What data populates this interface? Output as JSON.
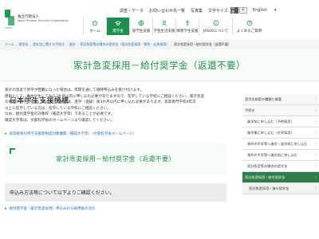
{
  "header": {
    "logo_small": "独立行政法人",
    "logo_main": "日本学生支援機構",
    "logo_en": "Japan Student Services Organization",
    "logo_abbr": "JASSO",
    "utility": [
      "調査・データ",
      "お問い合わせ先一覧",
      "写真集"
    ],
    "font_size_label": "文字サイズ",
    "font_sizes": [
      "標準",
      "大"
    ],
    "language": "English",
    "nav": [
      {
        "label": "ホーム",
        "icon": "home-icon"
      },
      {
        "label": "奨学金",
        "icon": "scholarship-icon"
      },
      {
        "label": "留学生支援",
        "icon": "globe-icon"
      },
      {
        "label": "学生生活支援",
        "icon": "student-icon"
      },
      {
        "label": "障害学生支援",
        "icon": "accessibility-icon"
      },
      {
        "label": "JASSOについて",
        "icon": "info-icon"
      },
      {
        "label": "よくあるご質問",
        "icon": "question-icon"
      }
    ],
    "active_nav_index": 1,
    "accent_color": "#1f8f4e"
  },
  "breadcrumb": [
    "ホーム",
    "奨学金",
    "奨学金に関する手続き",
    "進学",
    "家計急変等の場合の奨学金（家計急変採用・緊急・応急採用）",
    "家計急変採用－給付奨学金（返還不要）"
  ],
  "page_title": "家計急変採用－給付奨学金（返還不要）",
  "intro_lines": [
    "家計の急変で修学が困難になった場合は、年間を通して随時申込みを受け付けます。",
    "原則として、事由が生じてから3か月以内に申し込む必要がありますので、在学している学校にご相談ください。家計急変",
    "の事由が進学（進級）後に生じた場合は、進学（進級）後3か月以内に申し込む必要があります。高等専門学校4年次",
    "以上に在学している方は、在学している学校にご相談ください。",
    "なお、給付奨学金の対象校（確認大学等）であることが必要です。",
    "確認大学等は、文部科学省のホームページより確認してください。"
  ],
  "related_link": "高等教育の修学支援新制度対象機関（確認大学等）（文部科学省ホームページ）",
  "sub_heading": "家計急変採用－給付奨学金（返還不要）",
  "qa_box": "申込み方法等について以下よりご確認ください。",
  "bottom_link": "給付奨学金（家計急変採用）申込みから採用後の流れ",
  "sidebar": [
    {
      "label": "奨学金制度の種類と概要",
      "type": "top"
    },
    {
      "label": "手続き",
      "type": "top"
    },
    {
      "label": "進学前に申し込む（予約採用）",
      "type": "sub"
    },
    {
      "label": "進学後に申し込む（在学採用）",
      "type": "sub"
    },
    {
      "label": "海外の大学等へ進学・留学前に申し込む",
      "type": "sub"
    },
    {
      "label": "海外の大学院へ進学前に申し込む",
      "type": "sub"
    },
    {
      "label": "家計急変等の場合の奨学金",
      "type": "sub"
    },
    {
      "label": "家計急変採用－給付奨学金",
      "type": "current"
    },
    {
      "label": "家計急変採用－貸与奨学金",
      "type": "deep"
    }
  ]
}
